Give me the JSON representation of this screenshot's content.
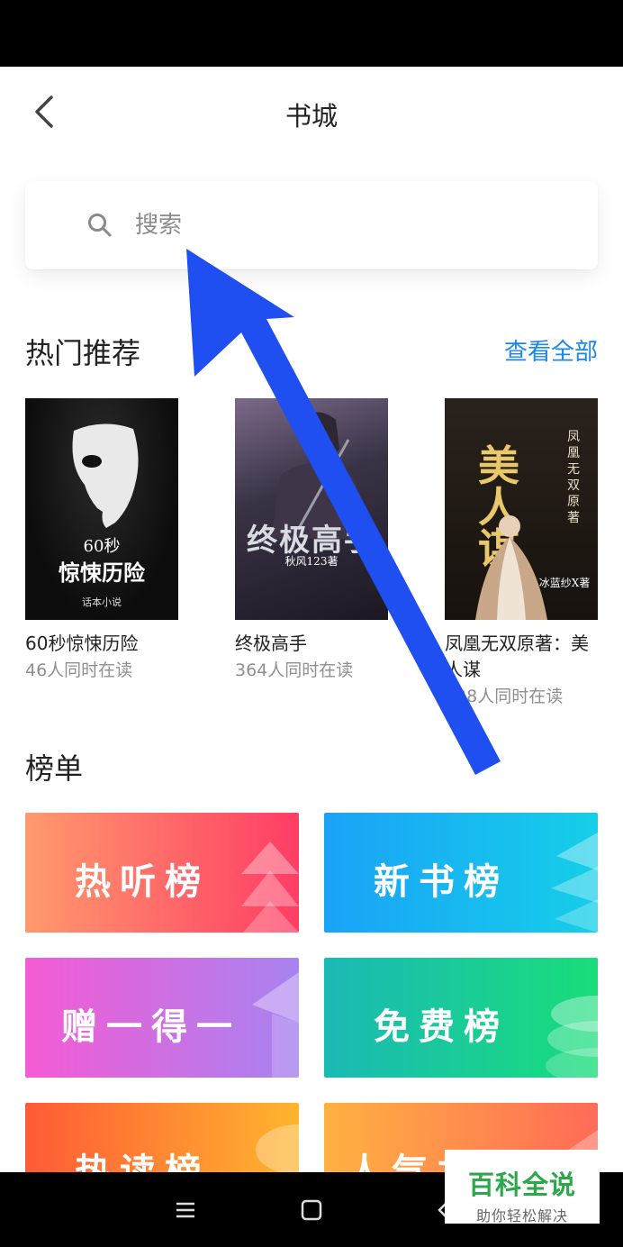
{
  "header": {
    "title": "书城",
    "back_icon": "chevron-left-icon"
  },
  "search": {
    "placeholder": "搜索",
    "icon": "search-icon"
  },
  "hot": {
    "title": "热门推荐",
    "see_all": "查看全部",
    "books": [
      {
        "title": "60秒惊悚历险",
        "readers": "46人同时在读",
        "cover_lines": [
          "60秒",
          "惊悚历险",
          "话本小说"
        ]
      },
      {
        "title": "终极高手",
        "readers": "364人同时在读",
        "cover_lines": [
          "终极高手",
          "秋风123著"
        ]
      },
      {
        "title": "凤凰无双原著：美人谋",
        "readers": "128人同时在读",
        "cover_lines": [
          "美人谋",
          "凤凰无双原著",
          "冰蓝纱X著"
        ]
      }
    ]
  },
  "rankings": {
    "title": "榜单",
    "cards": [
      {
        "label": "热听榜",
        "color_from": "#ff9a6c",
        "color_to": "#ff3d66"
      },
      {
        "label": "新书榜",
        "color_from": "#1aa2f7",
        "color_to": "#15cfe8"
      },
      {
        "label": "赠一得一",
        "color_from": "#f55bd4",
        "color_to": "#a783f0"
      },
      {
        "label": "免费榜",
        "color_from": "#1ab9b5",
        "color_to": "#19dd7a"
      },
      {
        "label": "热读榜",
        "color_from": "#ff5a36",
        "color_to": "#ffb52e"
      },
      {
        "label": "人气力推榜",
        "color_from": "#ffb142",
        "color_to": "#ff6b58"
      }
    ]
  },
  "nav": {
    "menu_icon": "menu-icon",
    "home_icon": "home-square-icon",
    "back_icon": "back-triangle-icon"
  },
  "watermark": {
    "main": "百科全说",
    "sub": "助你轻松解决"
  },
  "colors": {
    "accent": "#1b88e8",
    "arrow": "#1f4ff0",
    "watermark": "#2aa84a"
  }
}
